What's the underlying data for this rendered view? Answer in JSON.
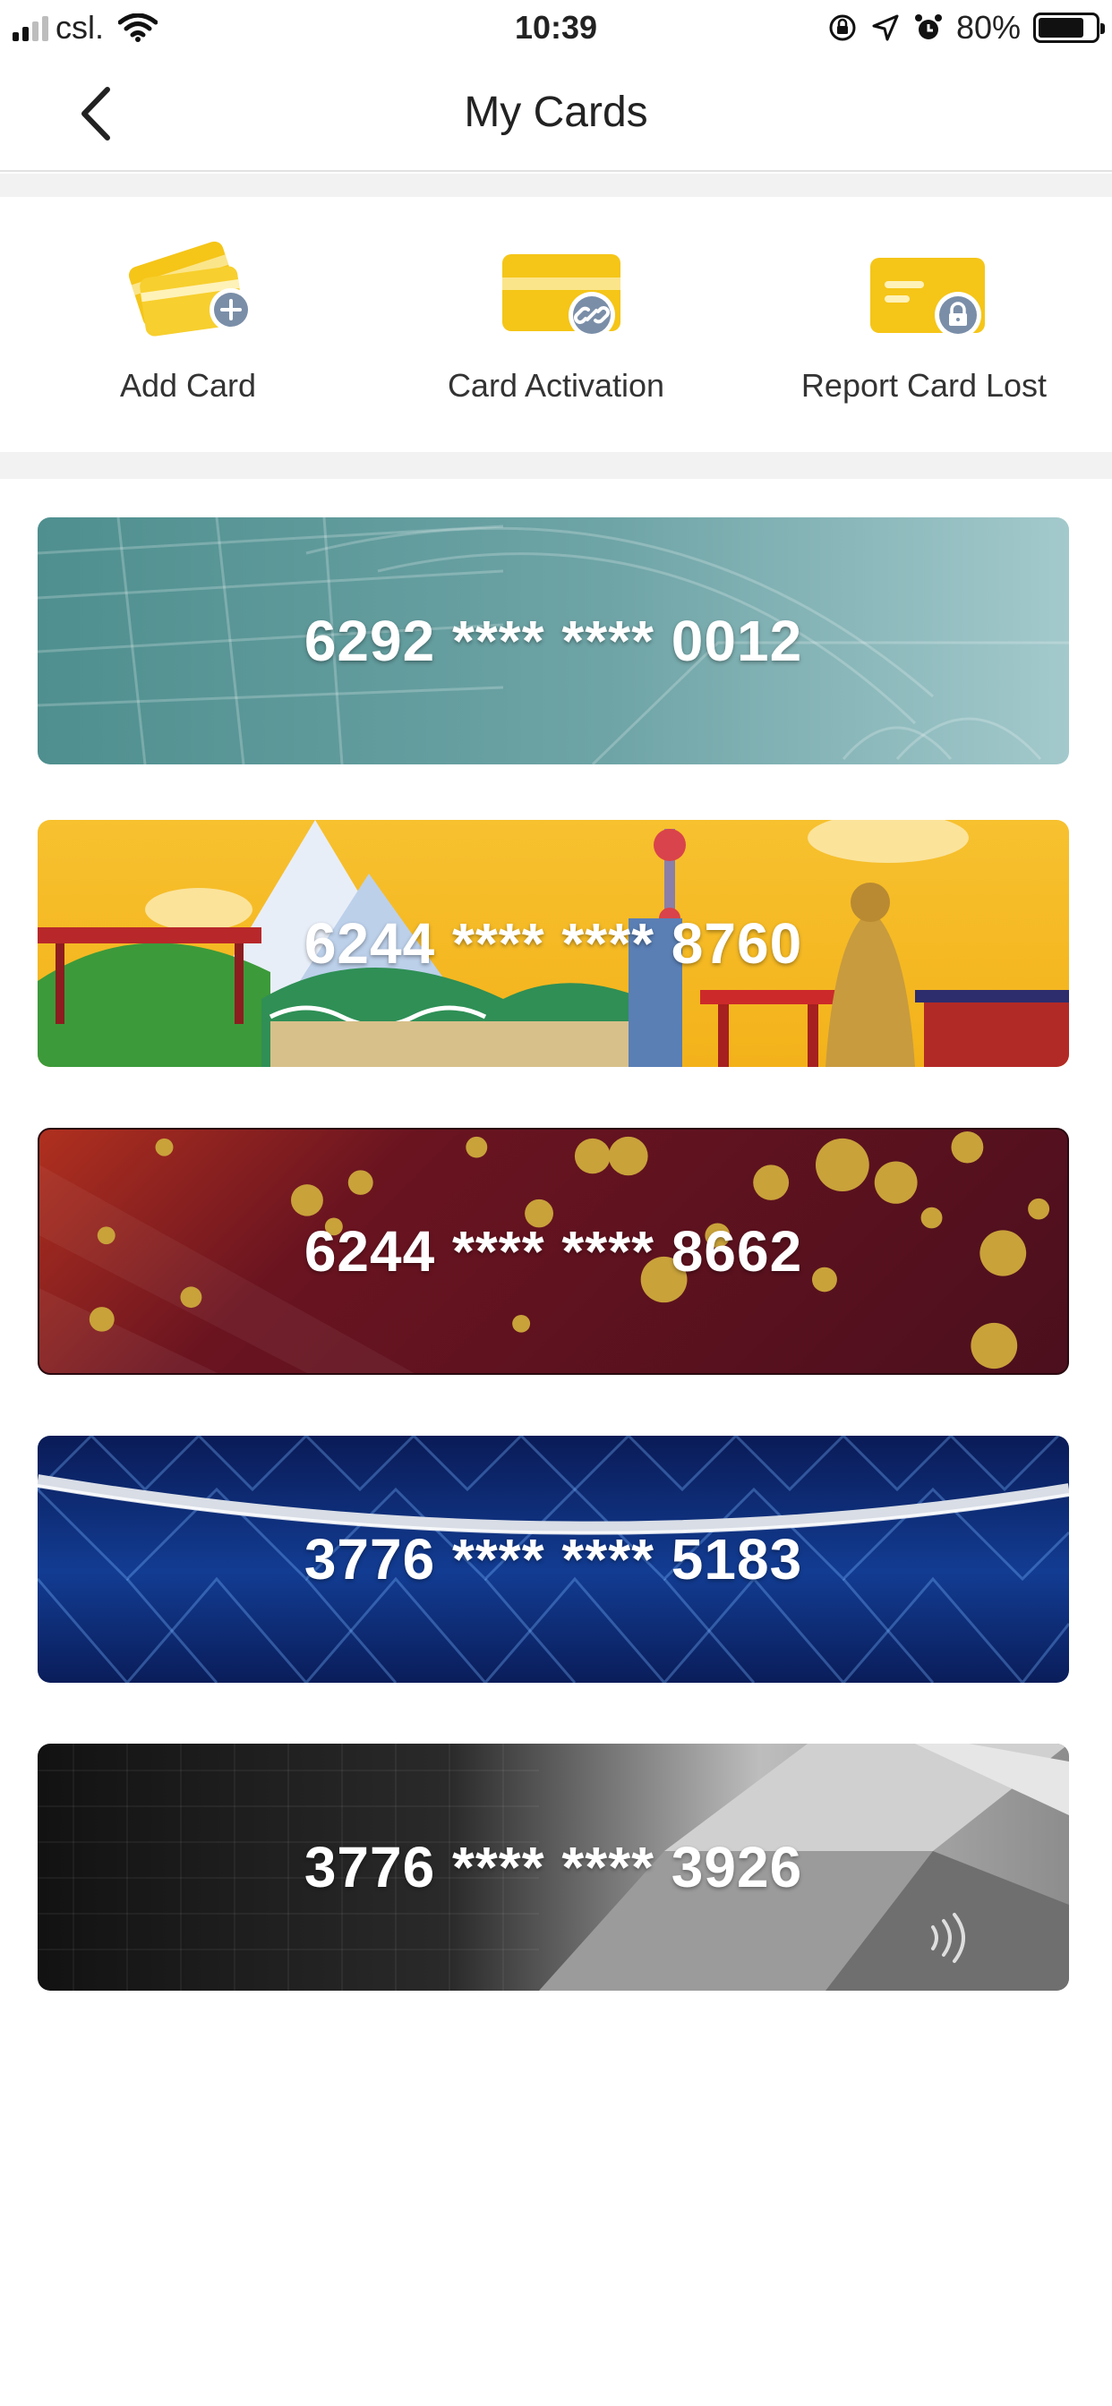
{
  "status_bar": {
    "carrier": "csl.",
    "time": "10:39",
    "battery_percent": "80%",
    "battery_level": 0.8,
    "icons": [
      "signal-icon",
      "wifi-icon",
      "screen-lock-icon",
      "location-arrow-icon",
      "alarm-icon",
      "battery-icon"
    ]
  },
  "nav": {
    "title": "My Cards",
    "back_icon": "chevron-left-icon"
  },
  "actions": [
    {
      "label": "Add Card",
      "icon": "add-card-icon"
    },
    {
      "label": "Card Activation",
      "icon": "card-link-icon"
    },
    {
      "label": "Report Card Lost",
      "icon": "card-lock-icon"
    }
  ],
  "colors": {
    "accent_yellow": "#f5c518",
    "badge_gray": "#7a8ea8"
  },
  "cards": [
    {
      "number": "6292 **** **** 0012",
      "theme": "teal-architecture"
    },
    {
      "number": "6244 **** **** 8760",
      "theme": "yellow-landmarks"
    },
    {
      "number": "6244 **** **** 8662",
      "theme": "maroon-gold-flowers"
    },
    {
      "number": "3776 **** **** 5183",
      "theme": "blue-diamond"
    },
    {
      "number": "3776 **** **** 3926",
      "theme": "black-silver-carbon"
    }
  ]
}
